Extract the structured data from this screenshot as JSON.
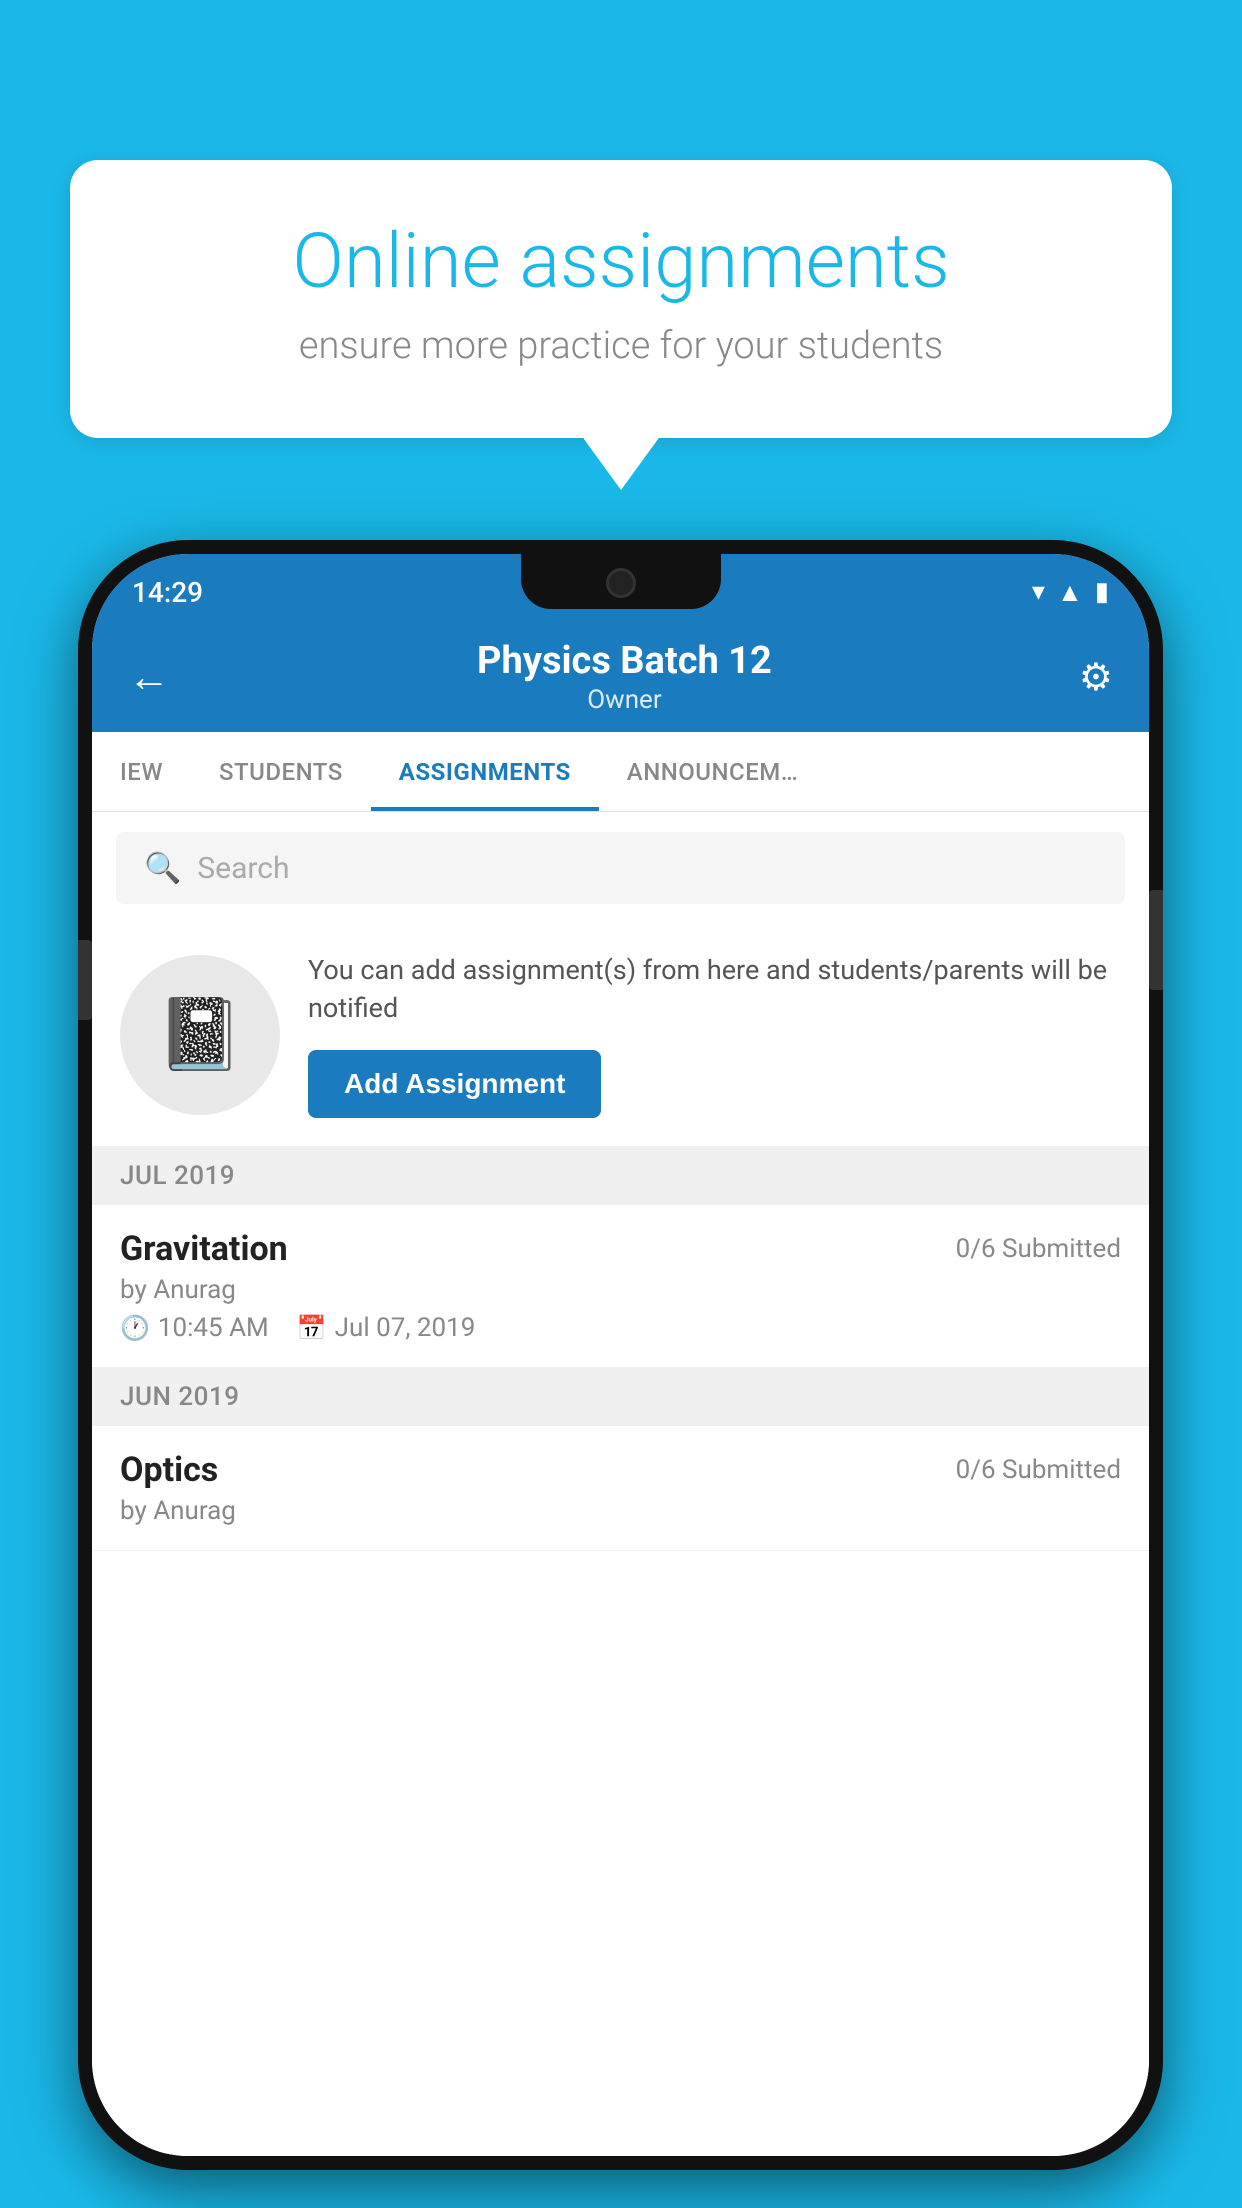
{
  "background": {
    "color": "#1ab8e8"
  },
  "speech_bubble": {
    "title": "Online assignments",
    "subtitle": "ensure more practice for your students"
  },
  "phone": {
    "status_bar": {
      "time": "14:29"
    },
    "header": {
      "title": "Physics Batch 12",
      "subtitle": "Owner",
      "back_label": "←",
      "settings_label": "⚙"
    },
    "tabs": [
      {
        "label": "IEW",
        "active": false
      },
      {
        "label": "STUDENTS",
        "active": false
      },
      {
        "label": "ASSIGNMENTS",
        "active": true
      },
      {
        "label": "ANNOUNCEM…",
        "active": false
      }
    ],
    "search": {
      "placeholder": "Search"
    },
    "promo": {
      "text": "You can add assignment(s) from here and students/parents will be notified",
      "button_label": "Add Assignment"
    },
    "sections": [
      {
        "label": "JUL 2019",
        "assignments": [
          {
            "name": "Gravitation",
            "submitted": "0/6 Submitted",
            "by": "by Anurag",
            "time": "10:45 AM",
            "date": "Jul 07, 2019"
          }
        ]
      },
      {
        "label": "JUN 2019",
        "assignments": [
          {
            "name": "Optics",
            "submitted": "0/6 Submitted",
            "by": "by Anurag",
            "time": "",
            "date": ""
          }
        ]
      }
    ]
  }
}
